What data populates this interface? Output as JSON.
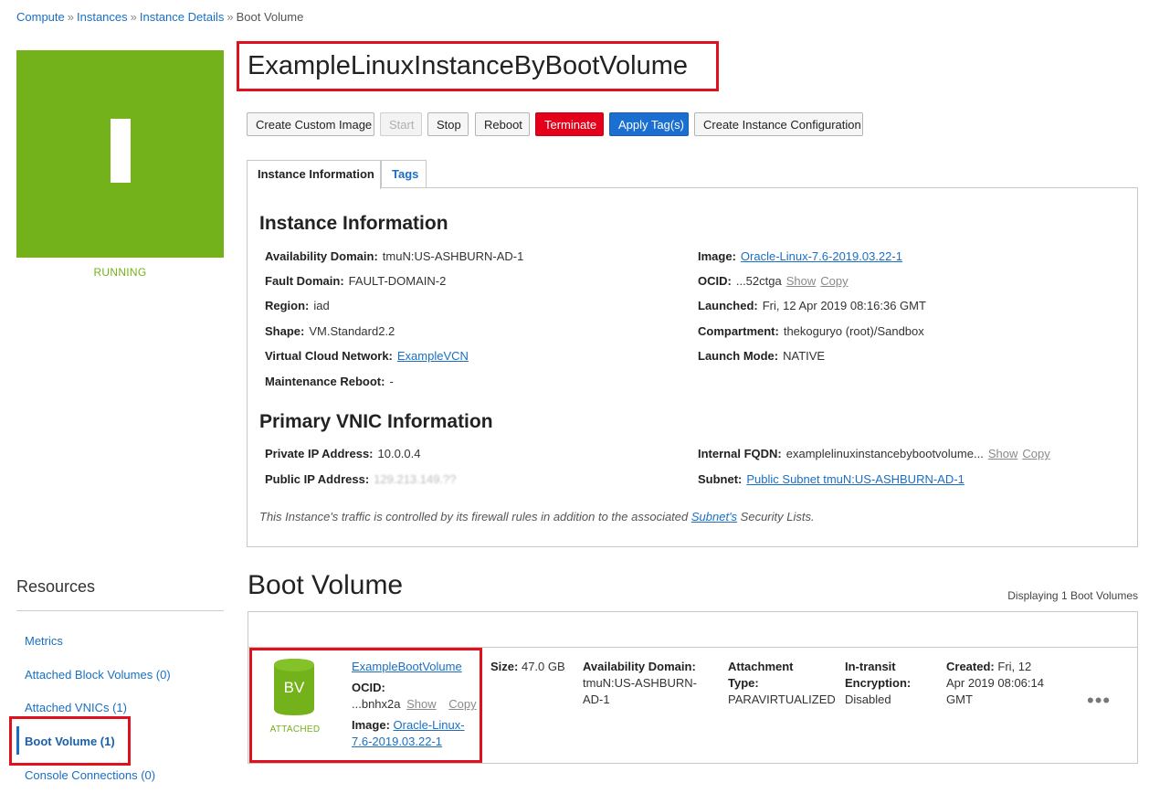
{
  "breadcrumb": [
    {
      "label": "Compute"
    },
    {
      "label": "Instances"
    },
    {
      "label": "Instance Details"
    },
    {
      "label": "Boot Volume"
    }
  ],
  "breadcrumb_separator": "»",
  "instance": {
    "icon_letter": "I",
    "state": "RUNNING",
    "state_color": "#73b21a",
    "title": "ExampleLinuxInstanceByBootVolume"
  },
  "actions": {
    "create_custom_image": "Create Custom Image",
    "start": "Start",
    "stop": "Stop",
    "reboot": "Reboot",
    "terminate": "Terminate",
    "apply_tags": "Apply Tag(s)",
    "create_instance_configuration": "Create Instance Configuration"
  },
  "tabs": {
    "instance_information": "Instance Information",
    "tags": "Tags"
  },
  "instance_info": {
    "heading": "Instance Information",
    "availability_domain": {
      "label": "Availability Domain:",
      "value": "tmuN:US-ASHBURN-AD-1"
    },
    "fault_domain": {
      "label": "Fault Domain:",
      "value": "FAULT-DOMAIN-2"
    },
    "region": {
      "label": "Region:",
      "value": "iad"
    },
    "shape": {
      "label": "Shape:",
      "value": "VM.Standard2.2"
    },
    "vcn": {
      "label": "Virtual Cloud Network:",
      "value": "ExampleVCN"
    },
    "maintenance_reboot": {
      "label": "Maintenance Reboot:",
      "value": "-"
    },
    "image": {
      "label": "Image:",
      "value": "Oracle-Linux-7.6-2019.03.22-1"
    },
    "ocid": {
      "label": "OCID:",
      "value": "...52ctga",
      "show": "Show",
      "copy": "Copy"
    },
    "launched": {
      "label": "Launched:",
      "value": "Fri, 12 Apr 2019 08:16:36 GMT"
    },
    "compartment": {
      "label": "Compartment:",
      "value": "thekoguryo (root)/Sandbox"
    },
    "launch_mode": {
      "label": "Launch Mode:",
      "value": "NATIVE"
    }
  },
  "vnic_info": {
    "heading": "Primary VNIC Information",
    "private_ip": {
      "label": "Private IP Address:",
      "value": "10.0.0.4"
    },
    "public_ip": {
      "label": "Public IP Address:",
      "value": "129.213.149.??"
    },
    "internal_fqdn": {
      "label": "Internal FQDN:",
      "value": "examplelinuxinstancebybootvolume...",
      "show": "Show",
      "copy": "Copy"
    },
    "subnet": {
      "label": "Subnet:",
      "value": "Public Subnet tmuN:US-ASHBURN-AD-1"
    },
    "note_prefix": "This Instance's traffic is controlled by its firewall rules in addition to the associated ",
    "note_link": "Subnet's",
    "note_suffix": " Security Lists."
  },
  "resources": {
    "title": "Resources",
    "items": [
      {
        "label": "Metrics"
      },
      {
        "label": "Attached Block Volumes (0)"
      },
      {
        "label": "Attached VNICs (1)"
      },
      {
        "label": "Boot Volume (1)"
      },
      {
        "label": "Console Connections (0)"
      }
    ]
  },
  "boot_volume": {
    "title": "Boot Volume",
    "count_text": "Displaying 1 Boot Volumes",
    "row": {
      "icon_text": "BV",
      "status": "ATTACHED",
      "name": "ExampleBootVolume",
      "ocid_label": "OCID:",
      "ocid_value": "...bnhx2a",
      "ocid_show": "Show",
      "ocid_copy": "Copy",
      "image_label": "Image:",
      "image_line1": "Oracle-Linux-",
      "image_line2": "7.6-2019.03.22-1",
      "size_label": "Size:",
      "size_value": "47.0 GB",
      "ad_label": "Availability Domain:",
      "ad_line1": "tmuN:US-ASHBURN-",
      "ad_line2": "AD-1",
      "attach_label1": "Attachment",
      "attach_label2": "Type:",
      "attach_value": "PARAVIRTUALIZED",
      "transit_label1": "In-transit",
      "transit_label2": "Encryption:",
      "transit_value": "Disabled",
      "created_label": "Created:",
      "created_line1": "Fri, 12",
      "created_line2": "Apr 2019 08:06:14",
      "created_line3": "GMT",
      "menu": "•••"
    }
  },
  "colors": {
    "accent_green": "#73b21a",
    "link_blue": "#1a6fc4",
    "terminate_red": "#e4001b",
    "primary_blue": "#1a6fd0",
    "highlight_red": "#e0101c"
  }
}
